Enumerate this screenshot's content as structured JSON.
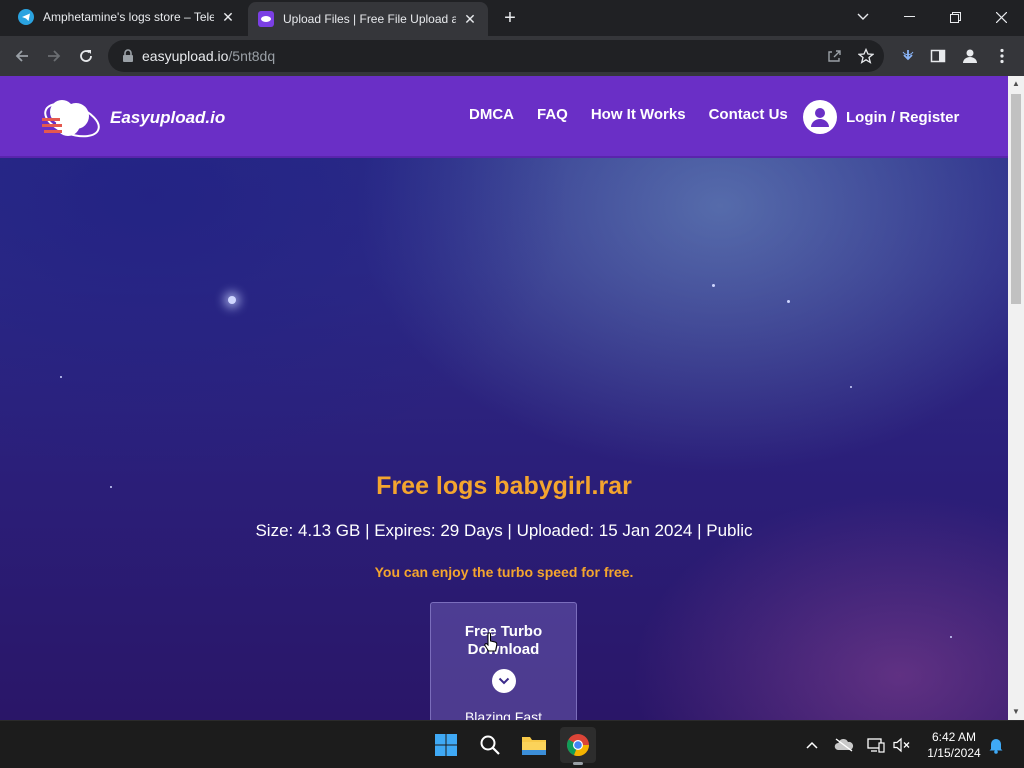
{
  "browser": {
    "tabs": [
      {
        "title": "Amphetamine's logs store – Tele",
        "active": false,
        "icon": "telegram-icon"
      },
      {
        "title": "Upload Files | Free File Upload a",
        "active": true,
        "icon": "easyupload-icon"
      }
    ],
    "url_domain": "easyupload.io",
    "url_path": "/5nt8dq"
  },
  "site": {
    "logo_text": "Easyupload.io",
    "nav": [
      "DMCA",
      "FAQ",
      "How It Works",
      "Contact Us"
    ],
    "login_label": "Login / Register",
    "brand_color": "#6a2fc6",
    "accent_color": "#f4a52e"
  },
  "file": {
    "name": "Free logs babygirl.rar",
    "meta": "Size: 4.13 GB | Expires: 29 Days | Uploaded: 15 Jan 2024 | Public",
    "turbo_note": "You can enjoy the turbo speed for free.",
    "download_label": "Free Turbo Download",
    "download_sub": "Blazing Fast"
  },
  "taskbar": {
    "apps": [
      "windows-start-icon",
      "search-icon",
      "file-explorer-icon",
      "chrome-icon"
    ],
    "time": "6:42 AM",
    "date": "1/15/2024"
  }
}
